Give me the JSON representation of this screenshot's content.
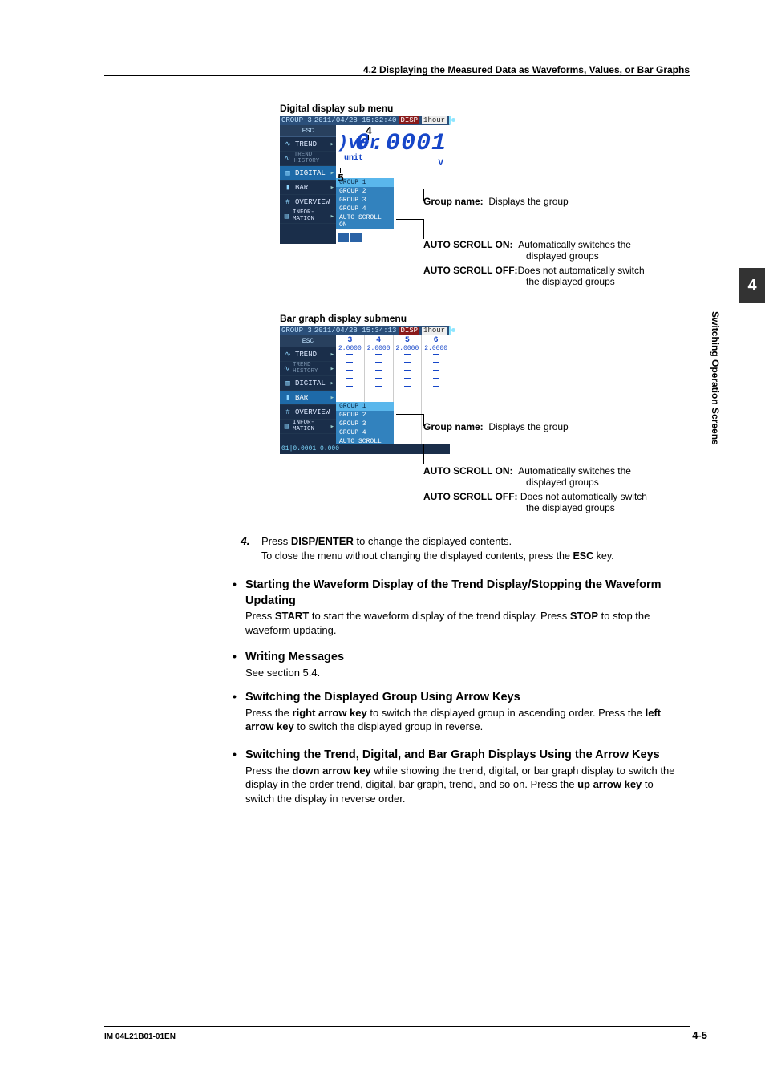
{
  "header": {
    "section": "4.2  Displaying the Measured Data as Waveforms, Values, or Bar Graphs"
  },
  "sidebar": {
    "chapter_num": "4",
    "chapter_label": "Switching Operation Screens"
  },
  "digital": {
    "title": "Digital display sub menu",
    "top": {
      "group": "GROUP 3",
      "timestamp": "2011/04/28 15:32:40",
      "disp": "DISP",
      "time": "1hour"
    },
    "esc": "ESC",
    "menu": [
      "TREND",
      "TREND HISTORY",
      "DIGITAL",
      "BAR",
      "OVERVIEW",
      "INFOR- MATION"
    ],
    "submenu": [
      "GROUP 1",
      "GROUP 2",
      "GROUP 3",
      "GROUP 4",
      "AUTO SCROLL ON"
    ],
    "annot_4": "4",
    "annot_5": "5",
    "over": ")ver",
    "unit": "unit",
    "big_value": "0.0001",
    "big_unit": "V",
    "callouts": {
      "group_name_label": "Group name:",
      "group_name_text": "Displays the group",
      "auto_on_label": "AUTO SCROLL ON:",
      "auto_on_text1": "Automatically switches the",
      "auto_on_text2": "displayed groups",
      "auto_off_label": "AUTO SCROLL OFF:",
      "auto_off_text1": "Does not automatically switch",
      "auto_off_text2": "the displayed groups"
    }
  },
  "bar": {
    "title": "Bar graph display submenu",
    "top": {
      "group": "GROUP 3",
      "timestamp": "2011/04/28 15:34:13",
      "disp": "DISP",
      "time": "1hour"
    },
    "esc": "ESC",
    "menu": [
      "TREND",
      "TREND HISTORY",
      "DIGITAL",
      "BAR",
      "OVERVIEW",
      "INFOR- MATION"
    ],
    "submenu": [
      "GROUP 1",
      "GROUP 2",
      "GROUP 3",
      "GROUP 4",
      "AUTO SCROLL ON"
    ],
    "cols": [
      {
        "num": "3",
        "val": "2.0000"
      },
      {
        "num": "4",
        "val": "2.0000"
      },
      {
        "num": "5",
        "val": "2.0000"
      },
      {
        "num": "6",
        "val": "2.0000"
      }
    ],
    "footer_text": "01|0.0001|0.000",
    "callouts": {
      "group_name_label": "Group name:",
      "group_name_text": "Displays the group",
      "auto_on_label": "AUTO SCROLL ON:",
      "auto_on_text1": "Automatically switches the",
      "auto_on_text2": "displayed groups",
      "auto_off_label": "AUTO SCROLL OFF:",
      "auto_off_text1": "Does not automatically switch",
      "auto_off_text2": "the displayed groups"
    }
  },
  "body": {
    "step4_num": "4.",
    "step4_l1a": "Press ",
    "step4_l1b": "DISP/ENTER",
    "step4_l1c": " to change the displayed contents.",
    "step4_l2a": "To close the menu without changing the displayed contents, press the ",
    "step4_l2b": "ESC",
    "step4_l2c": " key.",
    "h1": "Starting the Waveform Display of the Trend Display/Stopping the Waveform Updating",
    "p1a": "Press ",
    "p1b": "START",
    "p1c": " to start the waveform display of the trend display. Press ",
    "p1d": "STOP",
    "p1e": " to stop the waveform updating.",
    "h2": "Writing Messages",
    "p2": "See section 5.4.",
    "h3": "Switching the Displayed Group Using Arrow Keys",
    "p3a": "Press the ",
    "p3b": "right arrow key",
    "p3c": " to switch the displayed group in ascending order. Press the ",
    "p3d": "left arrow key",
    "p3e": " to switch the displayed group in reverse.",
    "h4": "Switching the Trend, Digital, and Bar Graph Displays Using the Arrow Keys",
    "p4a": "Press the ",
    "p4b": "down arrow key",
    "p4c": " while showing the trend, digital, or bar graph display to switch the display in the order trend, digital, bar graph, trend, and so on. Press the ",
    "p4d": "up arrow key",
    "p4e": " to switch the display in reverse order."
  },
  "footer": {
    "left": "IM 04L21B01-01EN",
    "right": "4-5"
  }
}
